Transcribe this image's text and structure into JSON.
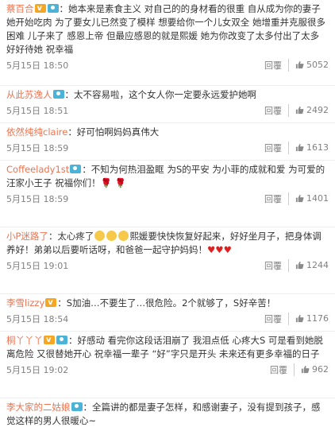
{
  "comments": [
    {
      "user": "蔡百合",
      "user_color": "#eb7350",
      "badges": [
        "vip",
        "cam"
      ],
      "text": "：她本来是素食主义 对自己的的身材看的很重 自从成为你的妻子 她开始吃肉 为了要女儿已然变了模样 想要给你一个儿女双全 她增重并克服很多困难 儿子来了 感恩上帝 但最应感恩的就是熙媛 她为你改变了太多付出了太多 好好待她 祝幸福",
      "time": "5月15日 18:50",
      "reply": "回覆",
      "likes": "5052"
    },
    {
      "user": "从此苏逸人",
      "user_color": "#eb7350",
      "badges": [
        "cam"
      ],
      "text": "：太不容易啦，这个女人你一定要永远爱护她啊",
      "time": "5月15日 18:51",
      "reply": "回覆",
      "likes": "2492"
    },
    {
      "user": "依然纯纯claire",
      "user_color": "#eb7350",
      "badges": [],
      "text": "：好可怕啊妈妈真伟大",
      "time": "5月15日 18:59",
      "reply": "回覆",
      "likes": "1613"
    },
    {
      "user": "Coffeelady1st",
      "user_color": "#eb7350",
      "badges": [
        "cam"
      ],
      "text": "：不知为何热泪盈眶 为S的平安 为小菲的成就和爱 为可爱的汪家小王子 祝福你们！",
      "suffix": "🌹 🌹",
      "time": "5月15日 18:59",
      "reply": "回覆",
      "likes": "1401"
    },
    {
      "user": "小P迷路了",
      "user_color": "#eb7350",
      "badges": [],
      "text_a": "：太心疼了",
      "text_b": "熙媛要快快恢复好起来，好好坐月子，把身体调养好！弟弟以后要听话呀，和爸爸一起守护妈妈！",
      "suffix": "♥♥♥",
      "time": "5月15日 19:01",
      "reply": "回覆",
      "likes": "1244"
    },
    {
      "user": "李雪lizzy",
      "user_color": "#eb7350",
      "badges": [
        "vip"
      ],
      "text": "：S加油…不要生了…很危险。2个就够了，S好辛苦！",
      "time": "5月15日 18:54",
      "reply": "回覆",
      "likes": "1176"
    },
    {
      "user": "桐丫丫丫",
      "user_color": "#eb7350",
      "badges": [
        "vip",
        "cam"
      ],
      "text": "：好感动 看完你这段话泪崩了 我泪点低 心疼大S 可是看到她脱离危险 又很替她开心 祝幸福一辈子 “好”字只是开头 未来还有更多幸福的日子",
      "time": "5月15日 19:02",
      "reply": "回覆",
      "likes": "962"
    },
    {
      "user": "李大家的二姑娘",
      "user_color": "#eb7350",
      "badges": [
        "cam"
      ],
      "text": "：全篇讲的都是妻子怎样，和感谢妻子，没有提到孩子，感觉这样的男人很暖心~"
    }
  ]
}
